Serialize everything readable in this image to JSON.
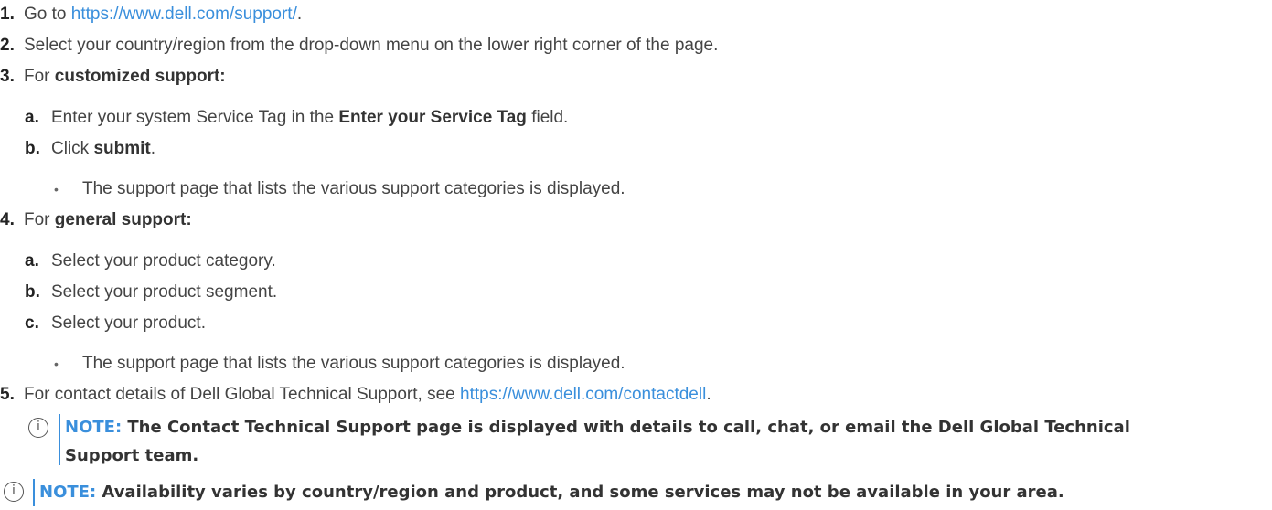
{
  "steps": {
    "s1": {
      "num": "1.",
      "prefix": "Go to ",
      "link": "https://www.dell.com/support/",
      "suffix": "."
    },
    "s2": {
      "num": "2.",
      "text": "Select your country/region from the drop-down menu on the lower right corner of the page."
    },
    "s3": {
      "num": "3.",
      "prefix": "For ",
      "bold": "customized support:",
      "a": {
        "num": "a.",
        "prefix": "Enter your system Service Tag in the ",
        "bold": "Enter your Service Tag",
        "suffix": " field."
      },
      "b": {
        "num": "b.",
        "prefix": "Click ",
        "bold": "submit",
        "suffix": "."
      },
      "bullet": "The support page that lists the various support categories is displayed."
    },
    "s4": {
      "num": "4.",
      "prefix": "For ",
      "bold": "general support:",
      "a": {
        "num": "a.",
        "text": "Select your product category."
      },
      "b": {
        "num": "b.",
        "text": "Select your product segment."
      },
      "c": {
        "num": "c.",
        "text": "Select your product."
      },
      "bullet": "The support page that lists the various support categories is displayed."
    },
    "s5": {
      "num": "5.",
      "prefix": "For contact details of Dell Global Technical Support, see ",
      "link": "https://www.dell.com/contactdell",
      "suffix": "."
    }
  },
  "bullet_char": "•",
  "notes": {
    "icon": "info-circle-icon",
    "icon_glyph": "i",
    "n1": {
      "label": "NOTE:",
      "line1": " The Contact Technical Support page is displayed with details to call, chat, or email the Dell Global Technical",
      "line2": "Support team."
    },
    "n2": {
      "label": "NOTE:",
      "text": " Availability varies by country/region and product, and some services may not be available in your area."
    }
  },
  "colors": {
    "link": "#3a8fdc",
    "text": "#444444",
    "note_bar": "#3a8fdc"
  }
}
